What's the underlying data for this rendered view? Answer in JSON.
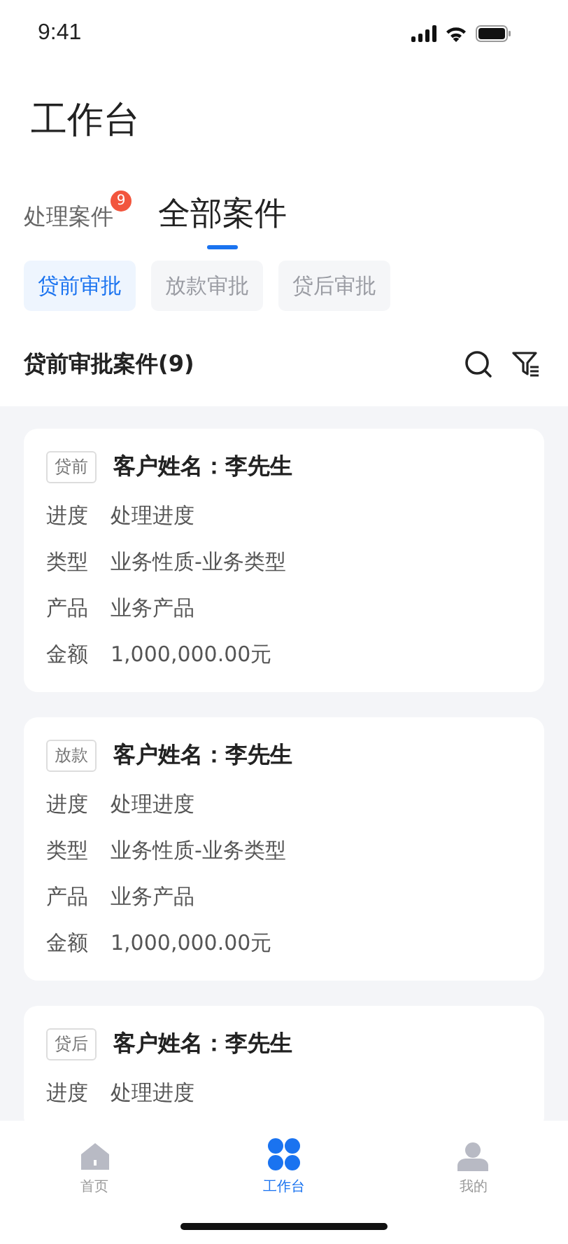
{
  "status_bar": {
    "time": "9:41"
  },
  "title": "工作台",
  "tabs": [
    {
      "label": "处理案件",
      "selected": false,
      "badge": "9"
    },
    {
      "label": "全部案件",
      "selected": true
    }
  ],
  "filters": [
    {
      "label": "贷前审批",
      "selected": true
    },
    {
      "label": "放款审批",
      "selected": false
    },
    {
      "label": "贷后审批",
      "selected": false
    }
  ],
  "section": {
    "title": "贷前审批案件(9)"
  },
  "cases": [
    {
      "tag": "贷前",
      "name": "客户姓名：李先生",
      "fields": [
        {
          "label": "进度",
          "value": "处理进度"
        },
        {
          "label": "类型",
          "value": "业务性质-业务类型"
        },
        {
          "label": "产品",
          "value": "业务产品"
        },
        {
          "label": "金额",
          "value": "1,000,000.00元"
        }
      ]
    },
    {
      "tag": "放款",
      "name": "客户姓名：李先生",
      "fields": [
        {
          "label": "进度",
          "value": "处理进度"
        },
        {
          "label": "类型",
          "value": "业务性质-业务类型"
        },
        {
          "label": "产品",
          "value": "业务产品"
        },
        {
          "label": "金额",
          "value": "1,000,000.00元"
        }
      ]
    },
    {
      "tag": "贷后",
      "name": "客户姓名：李先生",
      "fields": [
        {
          "label": "进度",
          "value": "处理进度"
        }
      ]
    }
  ],
  "tab_bar": [
    {
      "kind": "home",
      "label": "首页",
      "selected": false
    },
    {
      "kind": "workbench",
      "label": "工作台",
      "selected": true
    },
    {
      "kind": "profile",
      "label": "我的",
      "selected": false
    }
  ]
}
